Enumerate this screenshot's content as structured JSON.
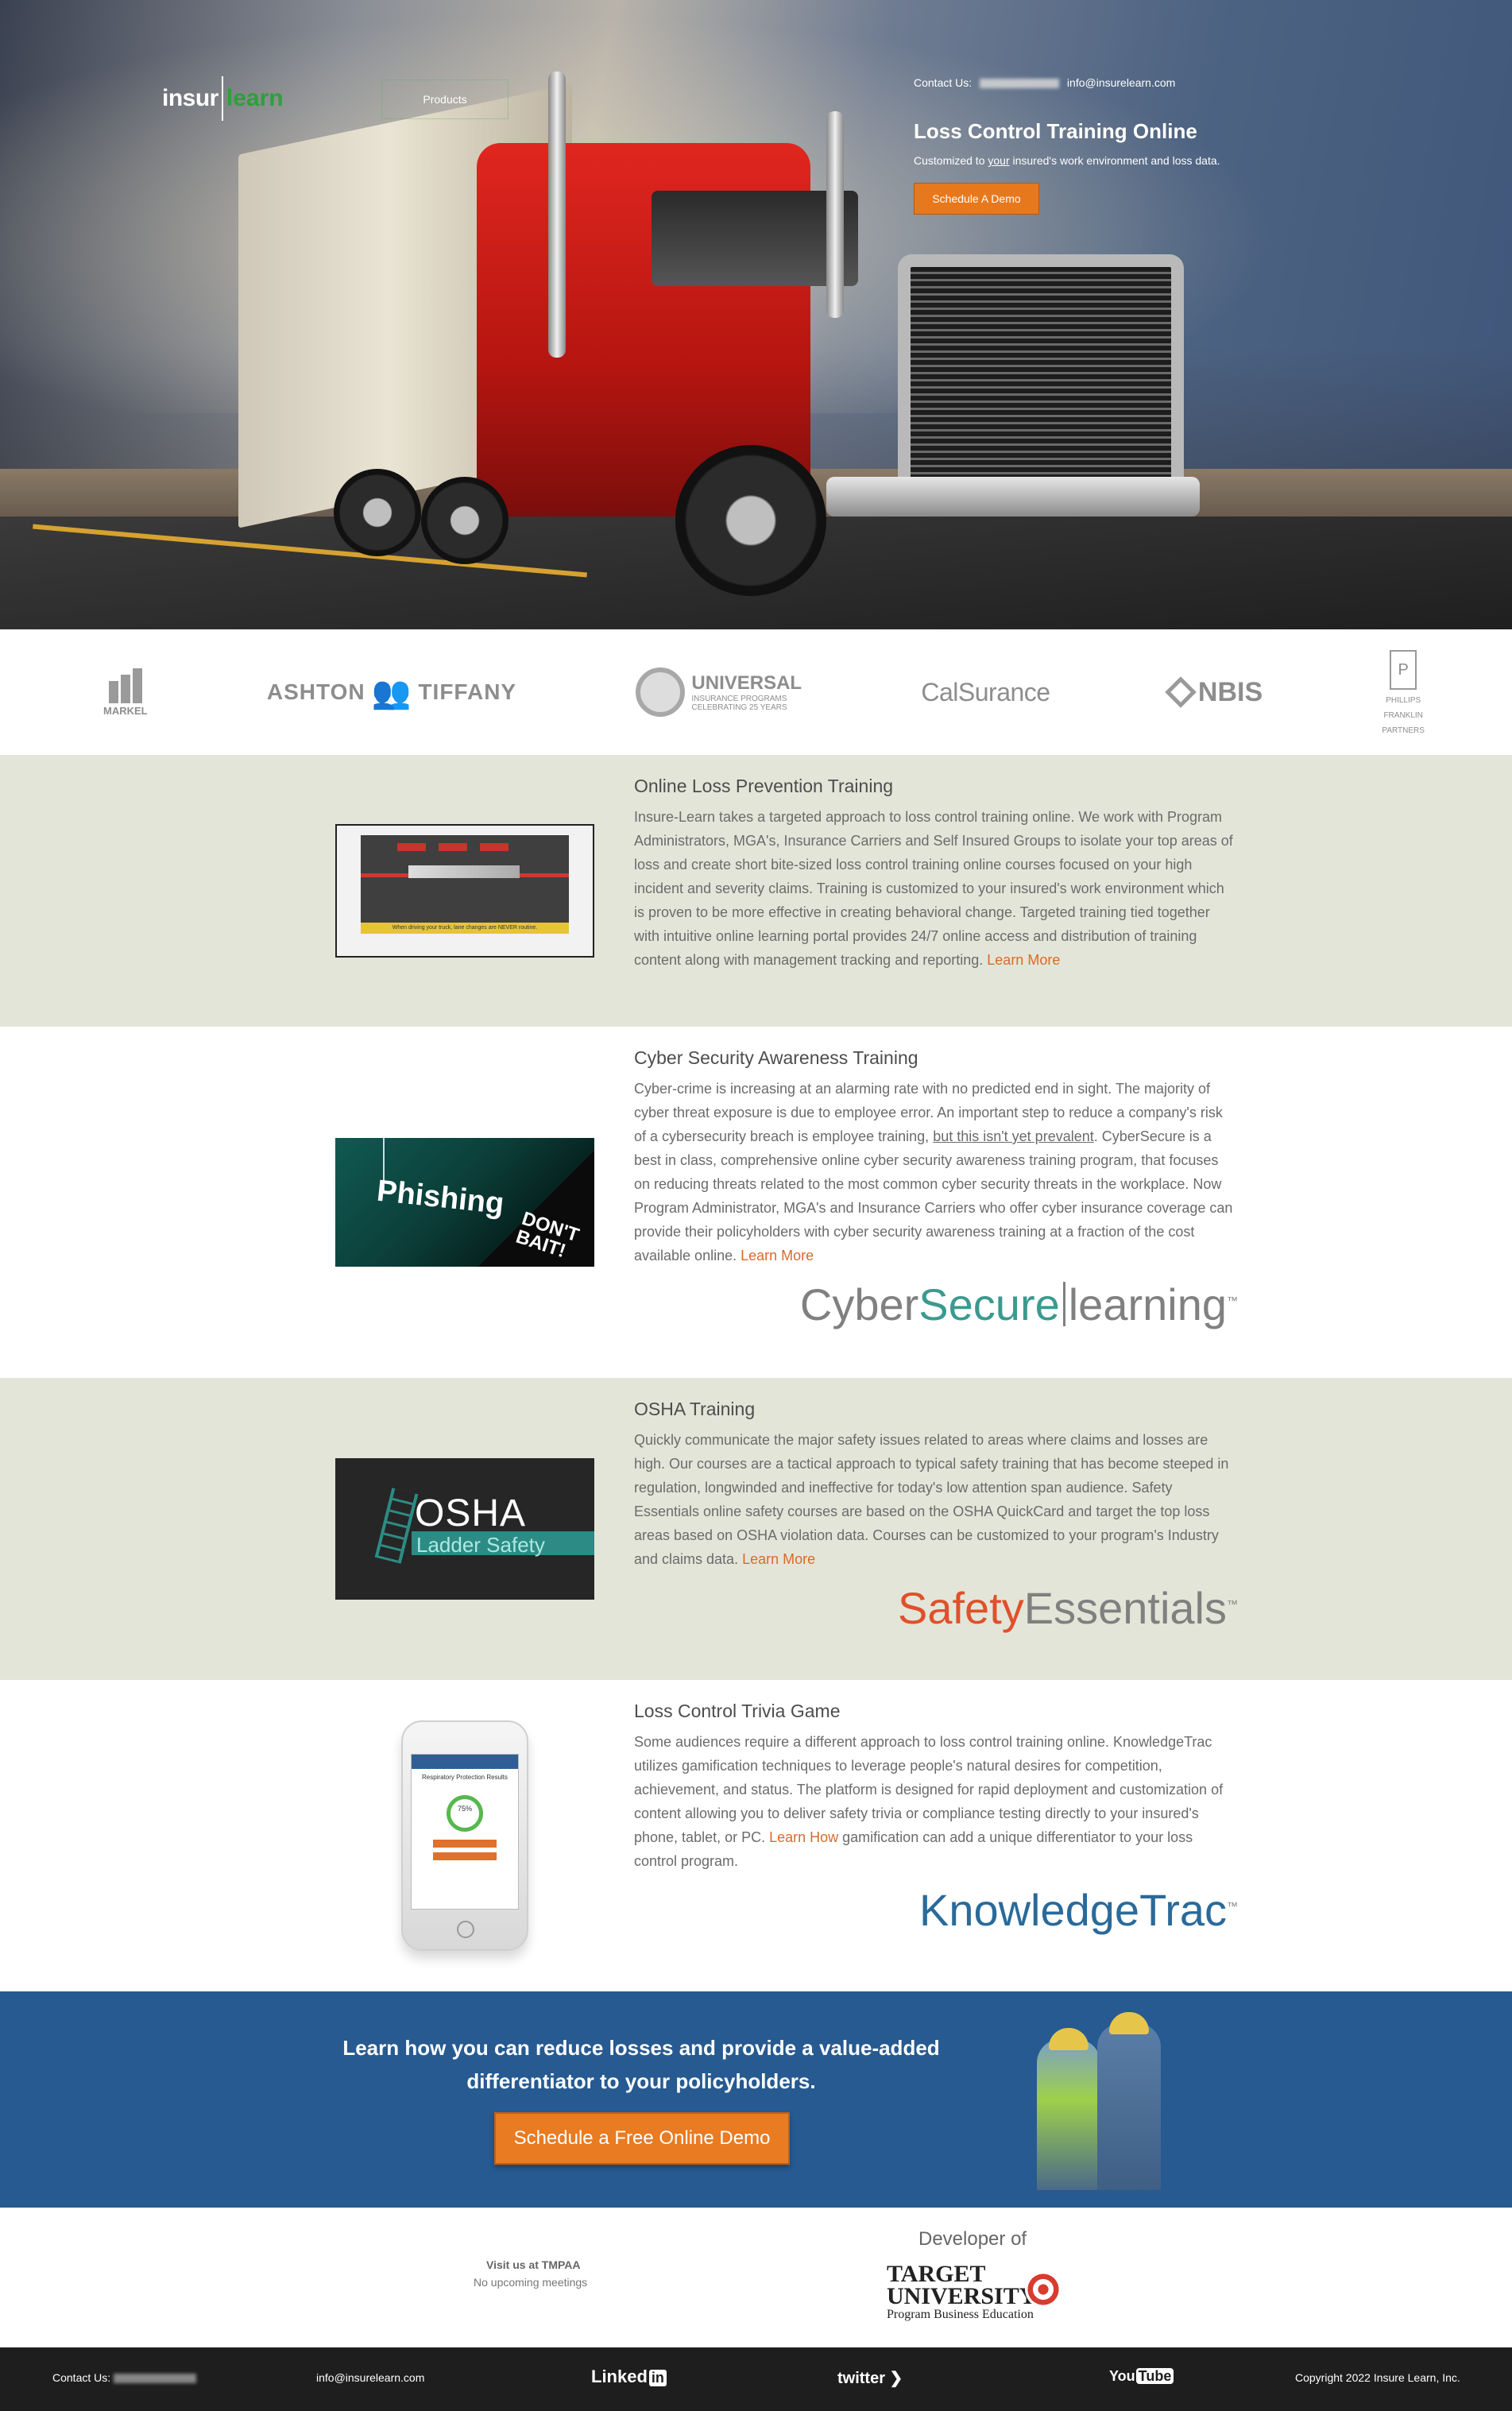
{
  "hero": {
    "logo_left": "insur",
    "logo_right": "learn",
    "nav_products": "Products",
    "contact_label": "Contact Us:",
    "contact_email": "info@insurelearn.com",
    "title": "Loss Control Training Online",
    "subtitle_pre": "Customized to ",
    "subtitle_underline": "your",
    "subtitle_post": " insured's work environment and loss data.",
    "cta": "Schedule A Demo"
  },
  "partners": {
    "markel": "MARKEL",
    "ashton": "ASHTON",
    "tiffany": "TIFFANY",
    "universal": "UNIVERSAL",
    "universal_sub1": "INSURANCE PROGRAMS",
    "universal_sub2": "CELEBRATING 25 YEARS",
    "calsurance": "CalSurance",
    "nbis": "NBIS",
    "phillips_1": "PHILLIPS",
    "phillips_2": "FRANKLIN",
    "phillips_3": "PARTNERS"
  },
  "sections": [
    {
      "title": "Online Loss Prevention Training",
      "body": "Insure-Learn takes a targeted approach to loss control training online. We work with Program Administrators, MGA's, Insurance Carriers and Self Insured Groups to isolate your top areas of loss and create short bite-sized loss control training online courses focused on your high incident and severity claims. Training is customized to your insured's work environment which is proven to be more effective in creating behavioral change. Targeted training tied together with intuitive online learning portal provides 24/7 online access and distribution of training content along with management tracking and reporting. ",
      "link": "Learn More",
      "image_caption": "When driving your truck, lane changes are NEVER routine."
    },
    {
      "title": "Cyber Security Awareness Training",
      "body_pre": "Cyber-crime is increasing at an alarming rate with no predicted end in sight. The majority of cyber threat exposure is due to employee error. An important step to reduce a company's risk of a cybersecurity breach is employee training, ",
      "body_underline": "but this isn't yet prevalent",
      "body_post": ". CyberSecure is a best in class, comprehensive online cyber security awareness training program, that focuses on reducing threats related to the most common cyber security threats in the workplace. Now Program Administrator, MGA's and Insurance Carriers who offer cyber insurance coverage can provide their policyholders with cyber security awareness training at a fraction of the cost available online. ",
      "link": "Learn More",
      "image_word": "Phishing",
      "image_dont": "DON'T",
      "image_bait": "BAIT!",
      "brand_a": "Cyber",
      "brand_b": "Secure",
      "brand_c": "learning",
      "tm": "™"
    },
    {
      "title": "OSHA Training",
      "body": "Quickly communicate the major safety issues related to areas where claims and losses are high. Our courses are a tactical approach to typical safety training that has become steeped in regulation, longwinded and ineffective for today's low attention span audience. Safety Essentials online safety courses are based on the OSHA QuickCard and target the top loss areas based on OSHA violation data. Courses can be customized to your program's Industry and claims data. ",
      "link": "Learn More",
      "image_title": "OSHA",
      "image_sub": "Ladder Safety",
      "brand_a": "Safety",
      "brand_b": "Essentials",
      "tm": "™"
    },
    {
      "title": "Loss Control Trivia Game",
      "body": "Some audiences require a different approach to loss control training online. KnowledgeTrac utilizes gamification techniques to leverage people's natural desires for competition, achievement, and status. The platform is designed for rapid deployment and customization of content allowing you to deliver safety trivia or compliance testing directly to your insured's phone, tablet, or PC. ",
      "link": "Learn How",
      "body_post": " gamification can add a unique differentiator to your loss control program.",
      "phone_title": "Respiratory Protection Results",
      "phone_percent": "75%",
      "brand_a": "KnowledgeTrac",
      "tm": "™"
    }
  ],
  "cta": {
    "headline": "Learn how you can reduce losses and provide a value-added differentiator to your policyholders.",
    "button": "Schedule a Free Online Demo"
  },
  "visit": {
    "title": "Visit us at TMPAA",
    "sub": "No upcoming meetings",
    "developer": "Developer of",
    "tu_1": "TARGET",
    "tu_2": "UNIVERSITY",
    "tu_3": "Program Business Education"
  },
  "footer": {
    "contact_label": "Contact Us:",
    "email": "info@insurelearn.com",
    "linkedin": "Linked",
    "linkedin_in": "in",
    "twitter": "twitter",
    "youtube_you": "You",
    "youtube_tube": "Tube",
    "copyright": "Copyright 2022 Insure Learn, Inc."
  },
  "colors": {
    "accent_orange": "#e8781c",
    "section_alt": "#e4e5d9",
    "cta_blue": "#265a91",
    "footer": "#1e1e1e",
    "brand_teal": "#3a9a8f",
    "brand_red": "#e0502a",
    "brand_blue": "#2a6a9a"
  }
}
